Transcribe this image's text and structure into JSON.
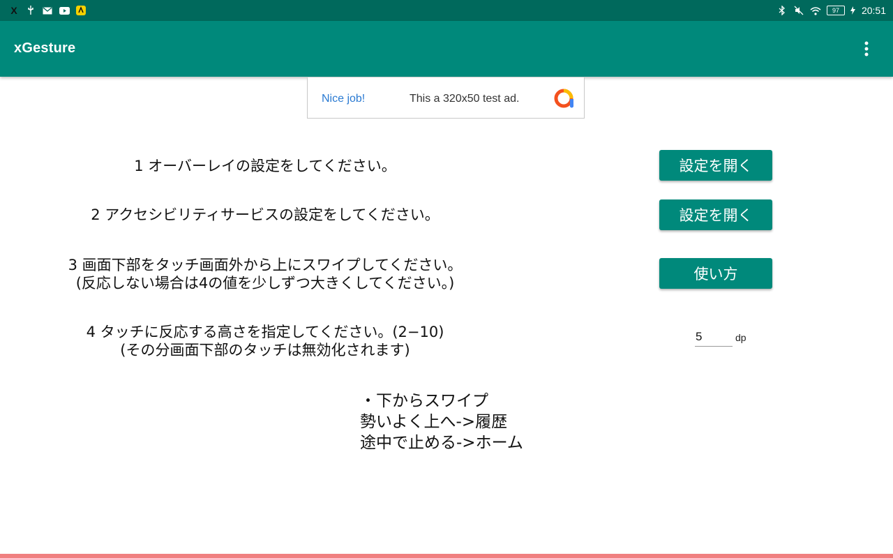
{
  "status_bar": {
    "left_icons": [
      "x-app-icon",
      "usb-icon",
      "mail-icon",
      "youtube-icon",
      "app-badge-icon"
    ],
    "battery": "97",
    "time": "20:51"
  },
  "app_bar": {
    "title": "xGesture",
    "menu_icon": "more-vert-icon"
  },
  "ad": {
    "label": "Nice job!",
    "text": "This a 320x50 test ad."
  },
  "steps": {
    "step1": {
      "text": "1 オーバーレイの設定をしてください。",
      "button": "設定を開く"
    },
    "step2": {
      "text": "2 アクセシビリティサービスの設定をしてください。",
      "button": "設定を開く"
    },
    "step3": {
      "line1": "3 画面下部をタッチ画面外から上にスワイプしてください。",
      "line2": "(反応しない場合は4の値を少しずつ大きくしてください。)",
      "button": "使い方"
    },
    "step4": {
      "line1": "4 タッチに反応する高さを指定してください。(2−10)",
      "line2": "(その分画面下部のタッチは無効化されます)",
      "value": "5",
      "unit": "dp"
    }
  },
  "help": {
    "line1": "・下からスワイプ",
    "line2": "勢いよく上へ->履歴",
    "line3": "途中で止める->ホーム"
  },
  "colors": {
    "status_bar": "#00695c",
    "app_bar": "#00897b",
    "button": "#00897b",
    "bottom_line": "#f08080"
  }
}
